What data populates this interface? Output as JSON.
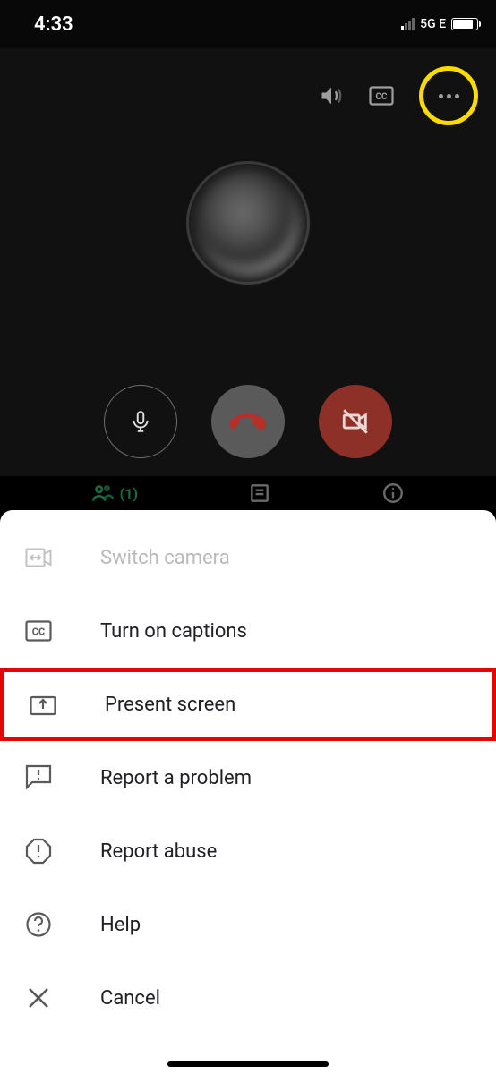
{
  "status": {
    "time": "4:33",
    "network": "5G E"
  },
  "peek": {
    "people_count": "(1)"
  },
  "menu": {
    "switch_camera": "Switch camera",
    "captions": "Turn on captions",
    "present": "Present screen",
    "report_problem": "Report a problem",
    "report_abuse": "Report abuse",
    "help": "Help",
    "cancel": "Cancel"
  },
  "highlight": {
    "more_button": true,
    "present_item": true
  }
}
